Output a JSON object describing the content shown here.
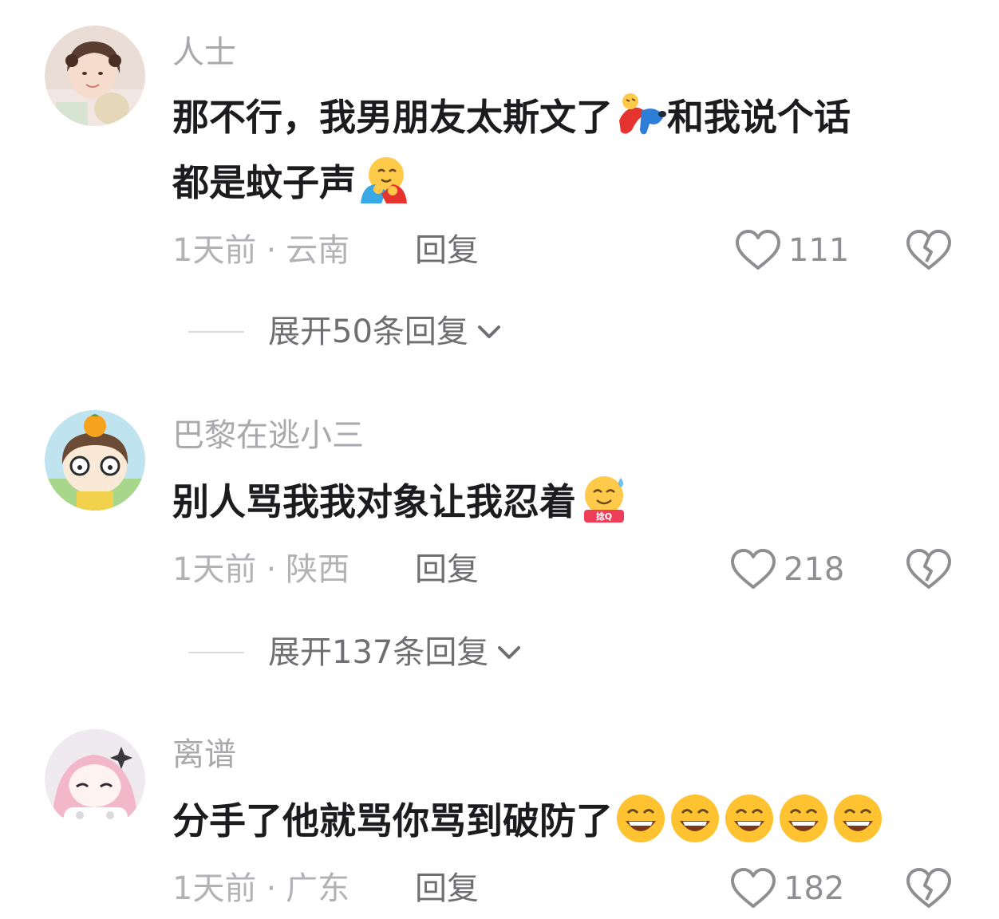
{
  "comments": [
    {
      "username": "人士",
      "text": "那不行，我男朋友太斯文了",
      "text2": "和我说个话",
      "text3": "都是蚊子声",
      "time": "1天前",
      "location": "云南",
      "reply_label": "回复",
      "likes": "111",
      "expand_label": "展开50条回复"
    },
    {
      "username": "巴黎在逃小三",
      "text": "别人骂我我对象让我忍着",
      "emoji_badge": "捻Q",
      "time": "1天前",
      "location": "陕西",
      "reply_label": "回复",
      "likes": "218",
      "expand_label": "展开137条回复"
    },
    {
      "username": "离谱",
      "text": "分手了他就骂你骂到破防了",
      "time": "1天前",
      "location": "广东",
      "reply_label": "回复",
      "likes": "182"
    }
  ],
  "meta_separator": "·",
  "icons": {
    "like": "heart-outline-icon",
    "dislike": "broken-heart-icon",
    "expand": "chevron-down-icon"
  },
  "colors": {
    "username": "#a9a9ad",
    "text": "#1c1c1e",
    "meta": "#b2b2b6",
    "icon": "#8e8e93"
  }
}
